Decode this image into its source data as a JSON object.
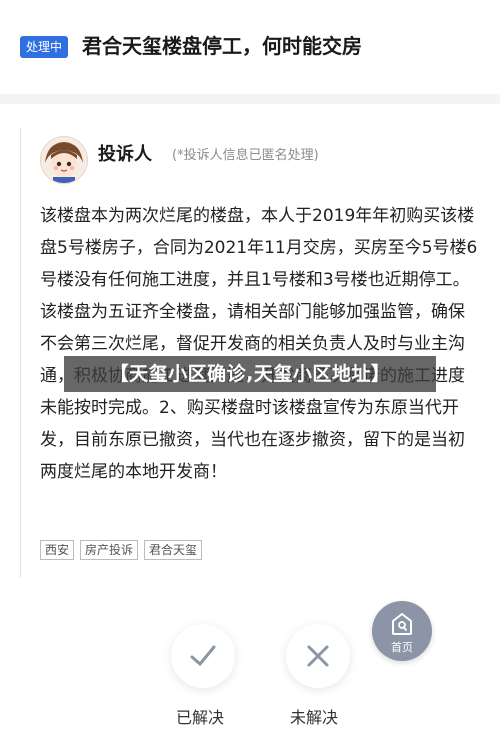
{
  "header": {
    "status_badge": "处理中",
    "title": "君合天玺楼盘停工，何时能交房"
  },
  "complaint": {
    "author": "投诉人",
    "anonymous_note": "(*投诉人信息已匿名处理)",
    "body": "该楼盘本为两次烂尾的楼盘，本人于2019年年初购买该楼盘5号楼房子，合同为2021年11月交房，买房至今5号楼6号楼没有任何施工进度，并且1号楼和3号楼也近期停工。该楼盘为五证齐全楼盘，请相关部门能够加强监管，确保不会第三次烂尾，督促开发商的相关负责人及时与业主沟通，积极协商施工进度问题，开发商多次承诺的施工进度未能按时完成。2、购买楼盘时该楼盘宣传为东原当代开发，目前东原已撤资，当代也在逐步撤资，留下的是当初两度烂尾的本地开发商！",
    "tags": [
      "西安",
      "房产投诉",
      "君合天玺"
    ]
  },
  "overlay_banner": "【天玺小区确诊,天玺小区地址】",
  "home_button": {
    "label": "首页",
    "icon": "home-icon"
  },
  "actions": {
    "resolved_label": "已解决",
    "unresolved_label": "未解决"
  },
  "colors": {
    "badge": "#2f6fe0",
    "home_button": "#8b95a7",
    "check": "#8a95a6",
    "cross": "#8a95a6"
  }
}
